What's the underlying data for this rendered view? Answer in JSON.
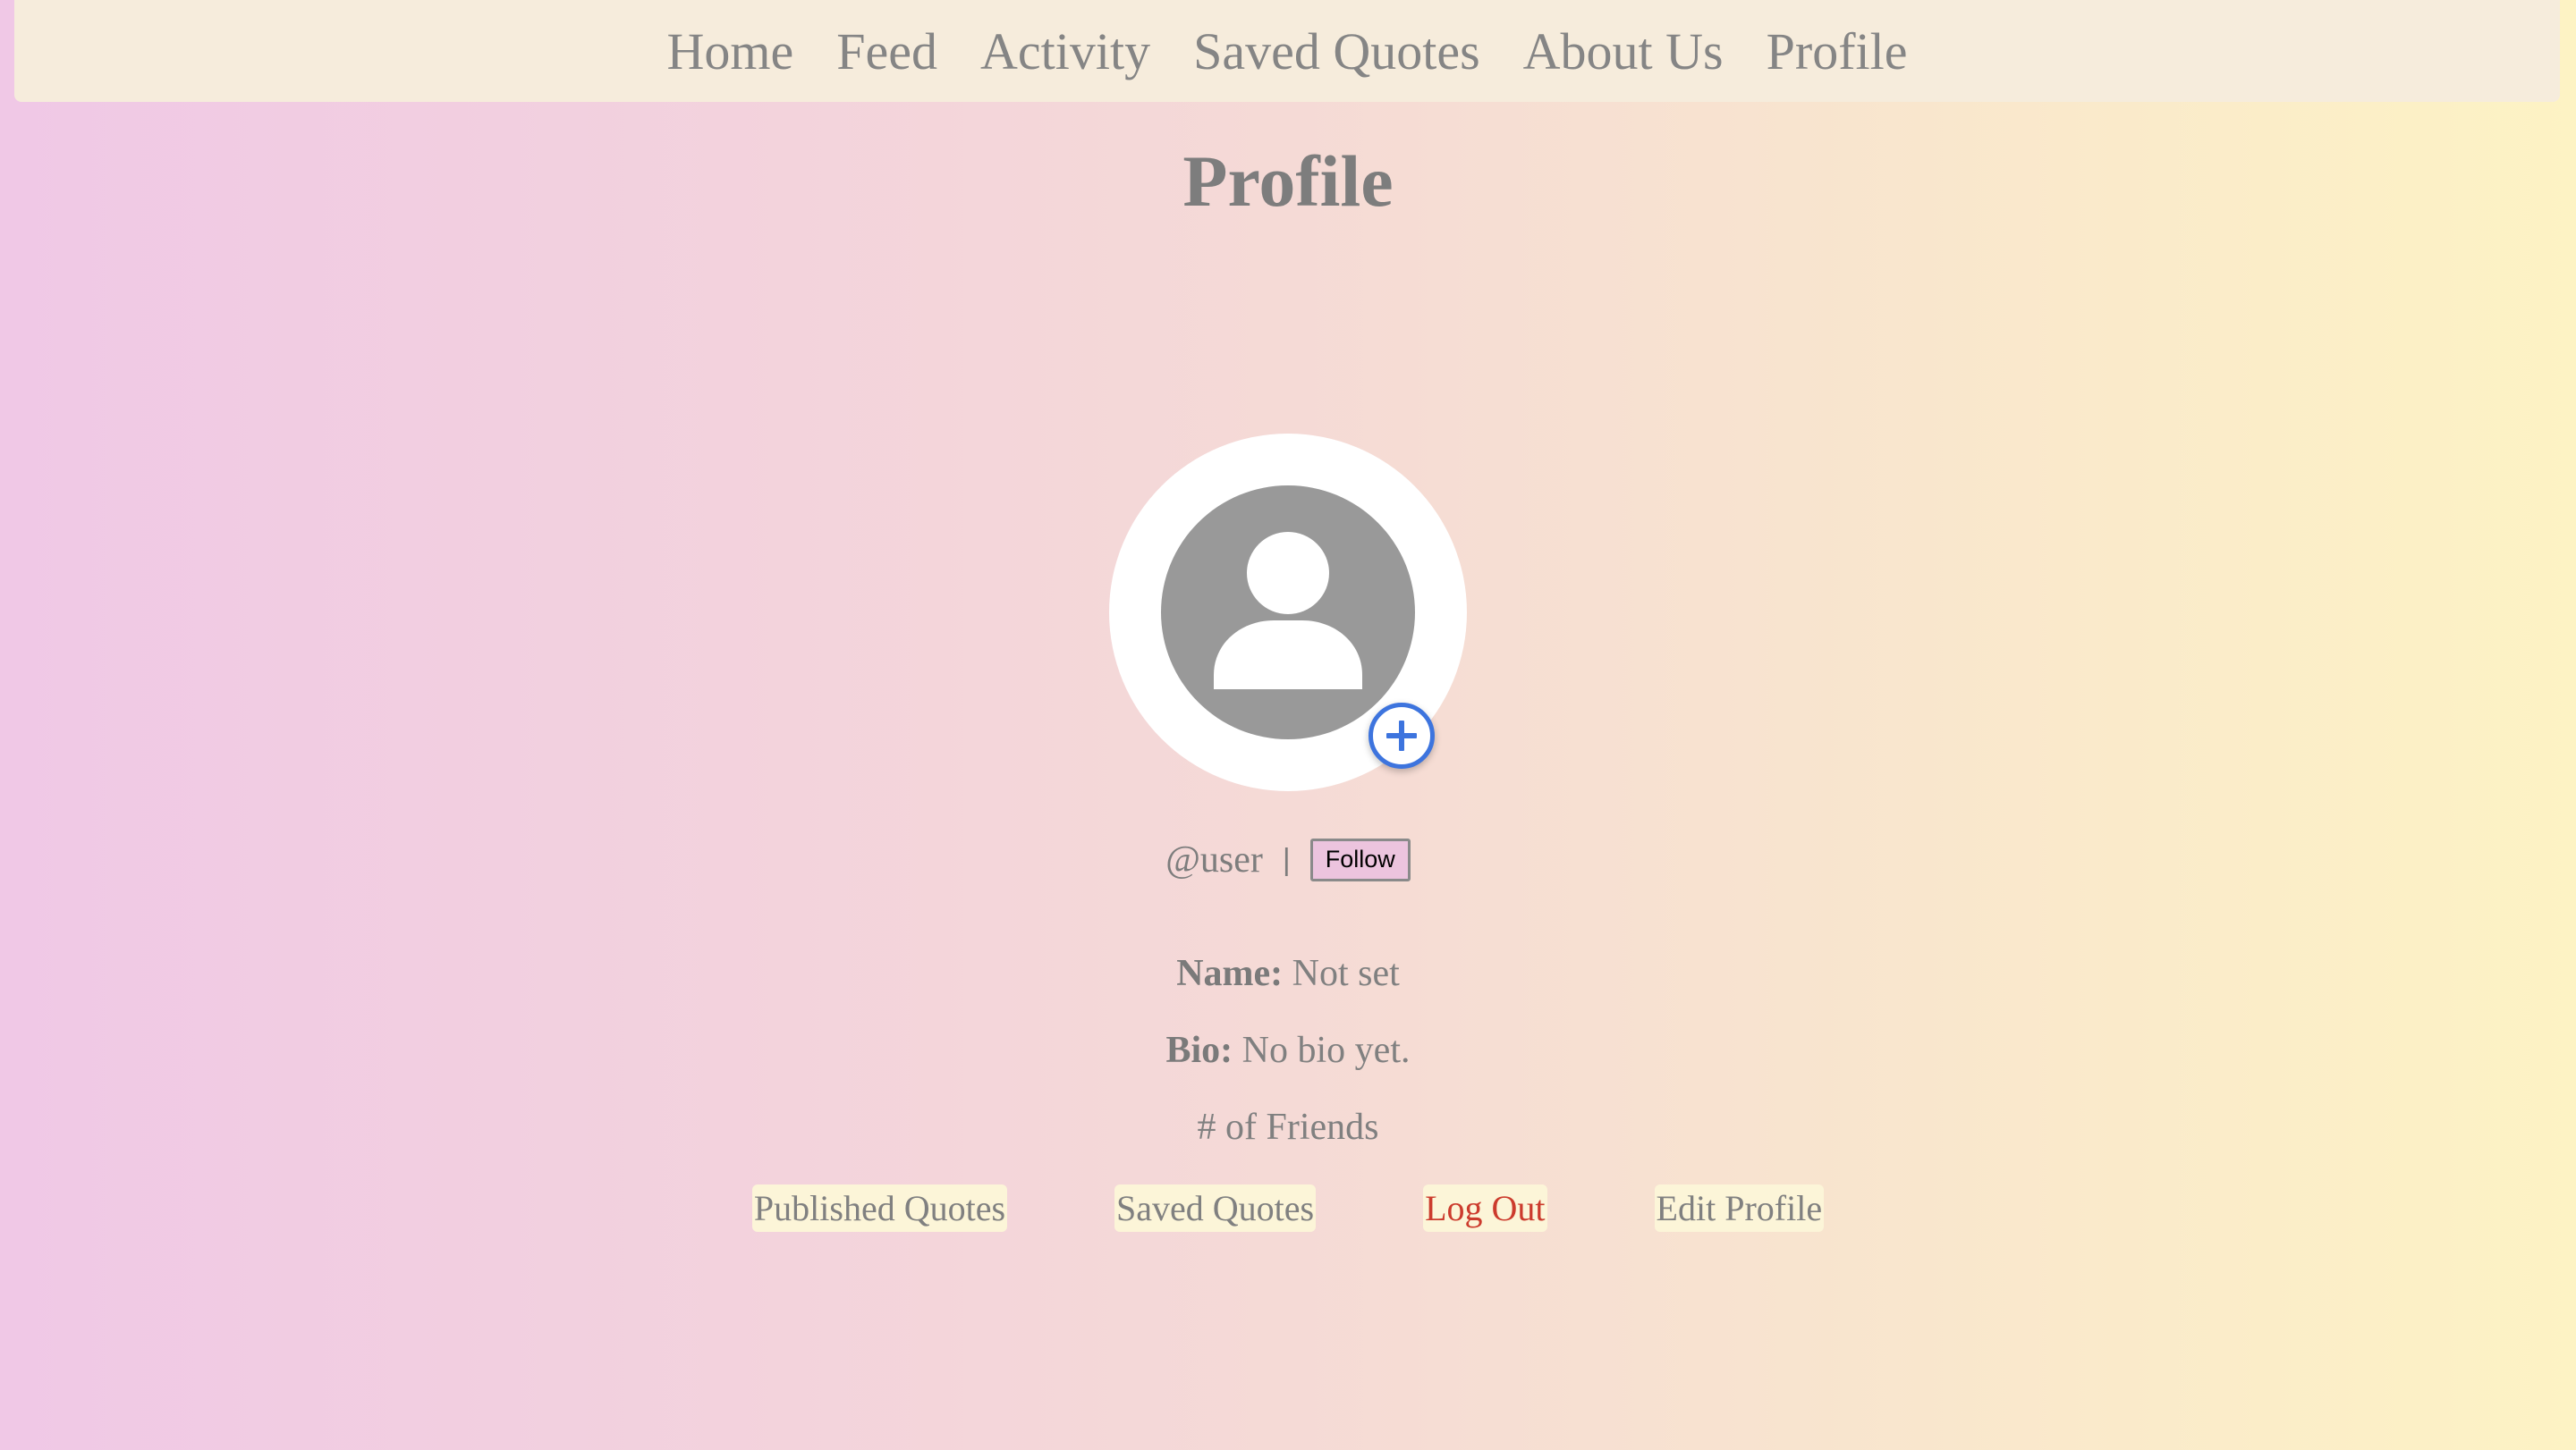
{
  "nav": {
    "items": [
      {
        "label": "Home"
      },
      {
        "label": "Feed"
      },
      {
        "label": "Activity"
      },
      {
        "label": "Saved Quotes"
      },
      {
        "label": "About Us"
      },
      {
        "label": "Profile"
      }
    ]
  },
  "page": {
    "title": "Profile"
  },
  "profile": {
    "avatar_icon": "user-silhouette-icon",
    "add_photo_icon": "plus-icon",
    "username": "@user",
    "separator": "|",
    "follow_label": "Follow",
    "name_label": "Name:",
    "name_value": "Not set",
    "bio_label": "Bio:",
    "bio_value": "No bio yet.",
    "friends_label": "# of Friends"
  },
  "actions": {
    "published_quotes": "Published Quotes",
    "saved_quotes": "Saved Quotes",
    "log_out": "Log Out",
    "edit_profile": "Edit Profile"
  },
  "colors": {
    "gradient_left": "#f0c8e6",
    "gradient_right": "#fdf3c4",
    "navbar": "#f6ecdc",
    "accent_blue": "#3d74de",
    "logout_red": "#cc3b2d",
    "follow_bg": "#ecc4de",
    "avatar_gray": "#999999"
  }
}
